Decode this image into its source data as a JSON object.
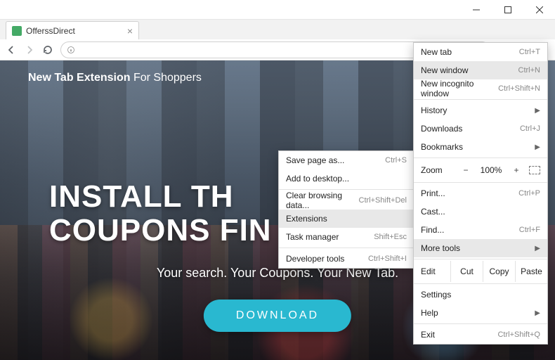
{
  "window": {
    "title": "OfferssDirect"
  },
  "addressbar": {
    "placeholder": ""
  },
  "page": {
    "tagline_bold": "New Tab Extension",
    "tagline_rest": " For Shoppers",
    "headline_l1": "INSTALL TH",
    "headline_l2": "COUPONS FIN",
    "subtitle": "Your search. Your Coupons. Your New Tab.",
    "download": "DOWNLOAD"
  },
  "menu": {
    "new_tab": "New tab",
    "new_tab_sc": "Ctrl+T",
    "new_window": "New window",
    "new_window_sc": "Ctrl+N",
    "incognito": "New incognito window",
    "incognito_sc": "Ctrl+Shift+N",
    "history": "History",
    "downloads": "Downloads",
    "downloads_sc": "Ctrl+J",
    "bookmarks": "Bookmarks",
    "zoom": "Zoom",
    "zoom_minus": "−",
    "zoom_pct": "100%",
    "zoom_plus": "+",
    "print": "Print...",
    "print_sc": "Ctrl+P",
    "cast": "Cast...",
    "find": "Find...",
    "find_sc": "Ctrl+F",
    "more_tools": "More tools",
    "edit": "Edit",
    "cut": "Cut",
    "copy": "Copy",
    "paste": "Paste",
    "settings": "Settings",
    "help": "Help",
    "exit": "Exit",
    "exit_sc": "Ctrl+Shift+Q"
  },
  "submenu": {
    "save_as": "Save page as...",
    "save_as_sc": "Ctrl+S",
    "add_desktop": "Add to desktop...",
    "clear_data": "Clear browsing data...",
    "clear_data_sc": "Ctrl+Shift+Del",
    "extensions": "Extensions",
    "task_mgr": "Task manager",
    "task_mgr_sc": "Shift+Esc",
    "devtools": "Developer tools",
    "devtools_sc": "Ctrl+Shift+I"
  }
}
